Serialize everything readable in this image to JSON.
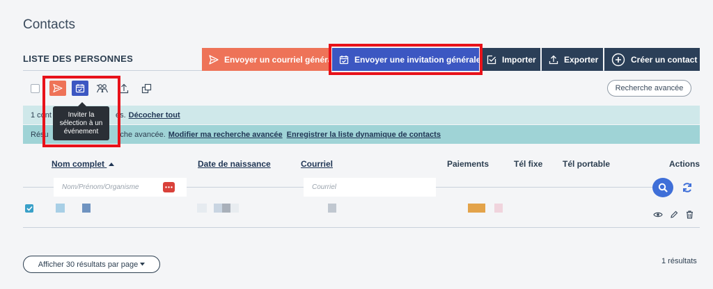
{
  "page": {
    "title": "Contacts"
  },
  "section": {
    "title": "LISTE DES PERSONNES"
  },
  "toolbar": {
    "send_mail": "Envoyer un courriel général",
    "send_invite": "Envoyer une invitation générale",
    "import": "Importer",
    "export": "Exporter",
    "create": "Créer un contact"
  },
  "selection_tools": {
    "icons": [
      "send-icon",
      "calendar-check-icon",
      "group-icon",
      "upload-icon",
      "copy-icon"
    ],
    "advanced_search": "Recherche avancée",
    "tooltip": "Inviter la sélection à un événement"
  },
  "info_bands": {
    "selection_prefix": "1 cont",
    "selection_suffix": "és.",
    "uncheck_all": "Décocher tout",
    "search_prefix": "Résu",
    "search_suffix": "rche avancée.",
    "modify_search": "Modifier ma recherche avancée",
    "save_dynamic_list": "Enregistrer la liste dynamique de contacts"
  },
  "table": {
    "headers": {
      "name": "Nom complet",
      "birth": "Date de naissance",
      "email": "Courriel",
      "payments": "Paiements",
      "phone": "Tél fixe",
      "mobile": "Tél portable",
      "actions": "Actions"
    },
    "filters": {
      "name_placeholder": "Nom/Prénom/Organisme",
      "email_placeholder": "Courriel"
    },
    "rows_selected": [
      true
    ]
  },
  "footer": {
    "per_page": "Afficher 30 résultats par page",
    "results": "1 résultats"
  },
  "colors": {
    "mail_button": "#ee7358",
    "invite_button": "#3c57c2",
    "dark_button": "#2b3f58",
    "highlight": "#e8121a",
    "band_light": "#cfe8ea",
    "band_dark": "#9fd3d6"
  }
}
